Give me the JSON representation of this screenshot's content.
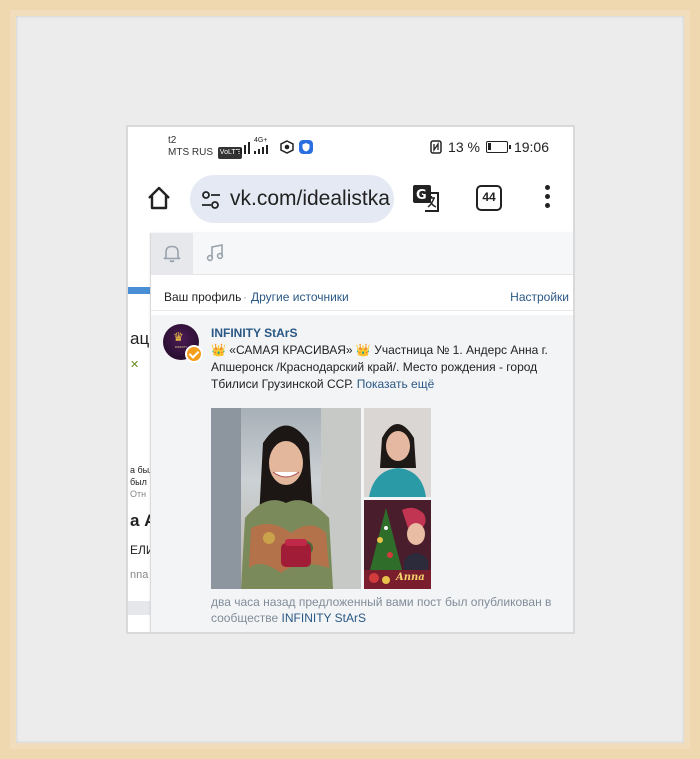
{
  "status_bar": {
    "network": "t2",
    "carrier": "MTS RUS",
    "volte": "VoLTE",
    "mobile_data": "4G+",
    "battery_percent": "13 %",
    "time": "19:06"
  },
  "browser": {
    "url": "vk.com/idealistka",
    "tab_count": "44"
  },
  "left_fragments": [
    "ац",
    "а был",
    "был",
    "Отн",
    "а А",
    "ЕЛИ",
    "nna"
  ],
  "notifications": {
    "filter": {
      "own": "Ваш профиль",
      "separator": "·",
      "other": "Другие источники",
      "settings": "Настройки"
    },
    "item": {
      "group_name": "INFINITY StArS",
      "emoji": "👑",
      "text_1": "«САМАЯ КРАСИВАЯ»",
      "text_2": "Участница № 1. Андерс Анна г. Апшеронск /Краснодарский край/. Место рождения - город Тбилиси Грузинской ССР.",
      "show_more": "Показать ещё",
      "photo_caption": "Anna",
      "caption_prefix": "два часа назад предложенный вами пост был опубликован в сообществе",
      "caption_link": "INFINITY StArS"
    }
  },
  "colors": {
    "link": "#2a5885",
    "muted": "#818c99",
    "verified_badge": "#f59d1c",
    "frame": "#efd7b0"
  }
}
